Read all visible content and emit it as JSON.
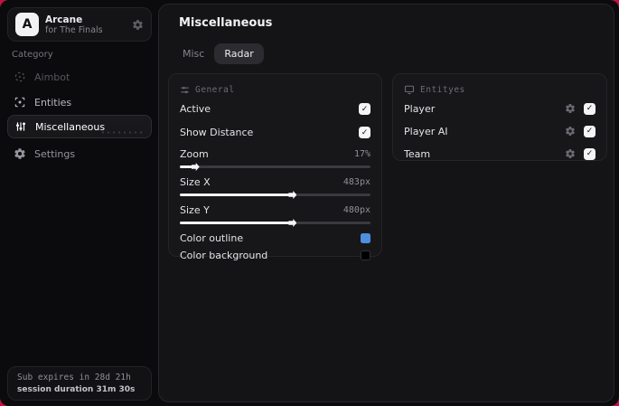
{
  "colors": {
    "desktop_background": "#c3123f",
    "window_background": "#0b0b0d",
    "panel_background": "#17171a",
    "accent_outline_swatch": "#4e8fe0",
    "background_swatch": "#000000"
  },
  "sidebar": {
    "brand": {
      "logo_letter": "A",
      "name": "Arcane",
      "subtitle": "for The Finals"
    },
    "category_label": "Category",
    "items": [
      {
        "label": "Aimbot",
        "icon": "crosshair-icon",
        "selected": false
      },
      {
        "label": "Entities",
        "icon": "scan-icon",
        "selected": false
      },
      {
        "label": "Miscellaneous",
        "icon": "sliders-icon",
        "selected": true
      },
      {
        "label": "Settings",
        "icon": "gear-icon",
        "selected": false
      }
    ],
    "footer": {
      "line1": "Sub expires in 28d 21h",
      "line2": "session duration 31m 30s"
    }
  },
  "main": {
    "title": "Miscellaneous",
    "tabs": [
      {
        "label": "Misc",
        "selected": false
      },
      {
        "label": "Radar",
        "selected": true
      }
    ],
    "general": {
      "title": "General",
      "checks": [
        {
          "label": "Active",
          "checked": true
        },
        {
          "label": "Show Distance",
          "checked": true
        }
      ],
      "sliders": [
        {
          "label": "Zoom",
          "value": "17%",
          "fill_percent": 7
        },
        {
          "label": "Size X",
          "value": "483px",
          "fill_percent": 58
        },
        {
          "label": "Size Y",
          "value": "480px",
          "fill_percent": 58
        }
      ],
      "colors": [
        {
          "label": "Color outline",
          "swatch": "#4e8fe0"
        },
        {
          "label": "Color background",
          "swatch": "#000000"
        }
      ]
    },
    "entities": {
      "title": "Entityes",
      "rows": [
        {
          "label": "Player",
          "checked": true
        },
        {
          "label": "Player AI",
          "checked": true
        },
        {
          "label": "Team",
          "checked": true
        }
      ]
    }
  }
}
